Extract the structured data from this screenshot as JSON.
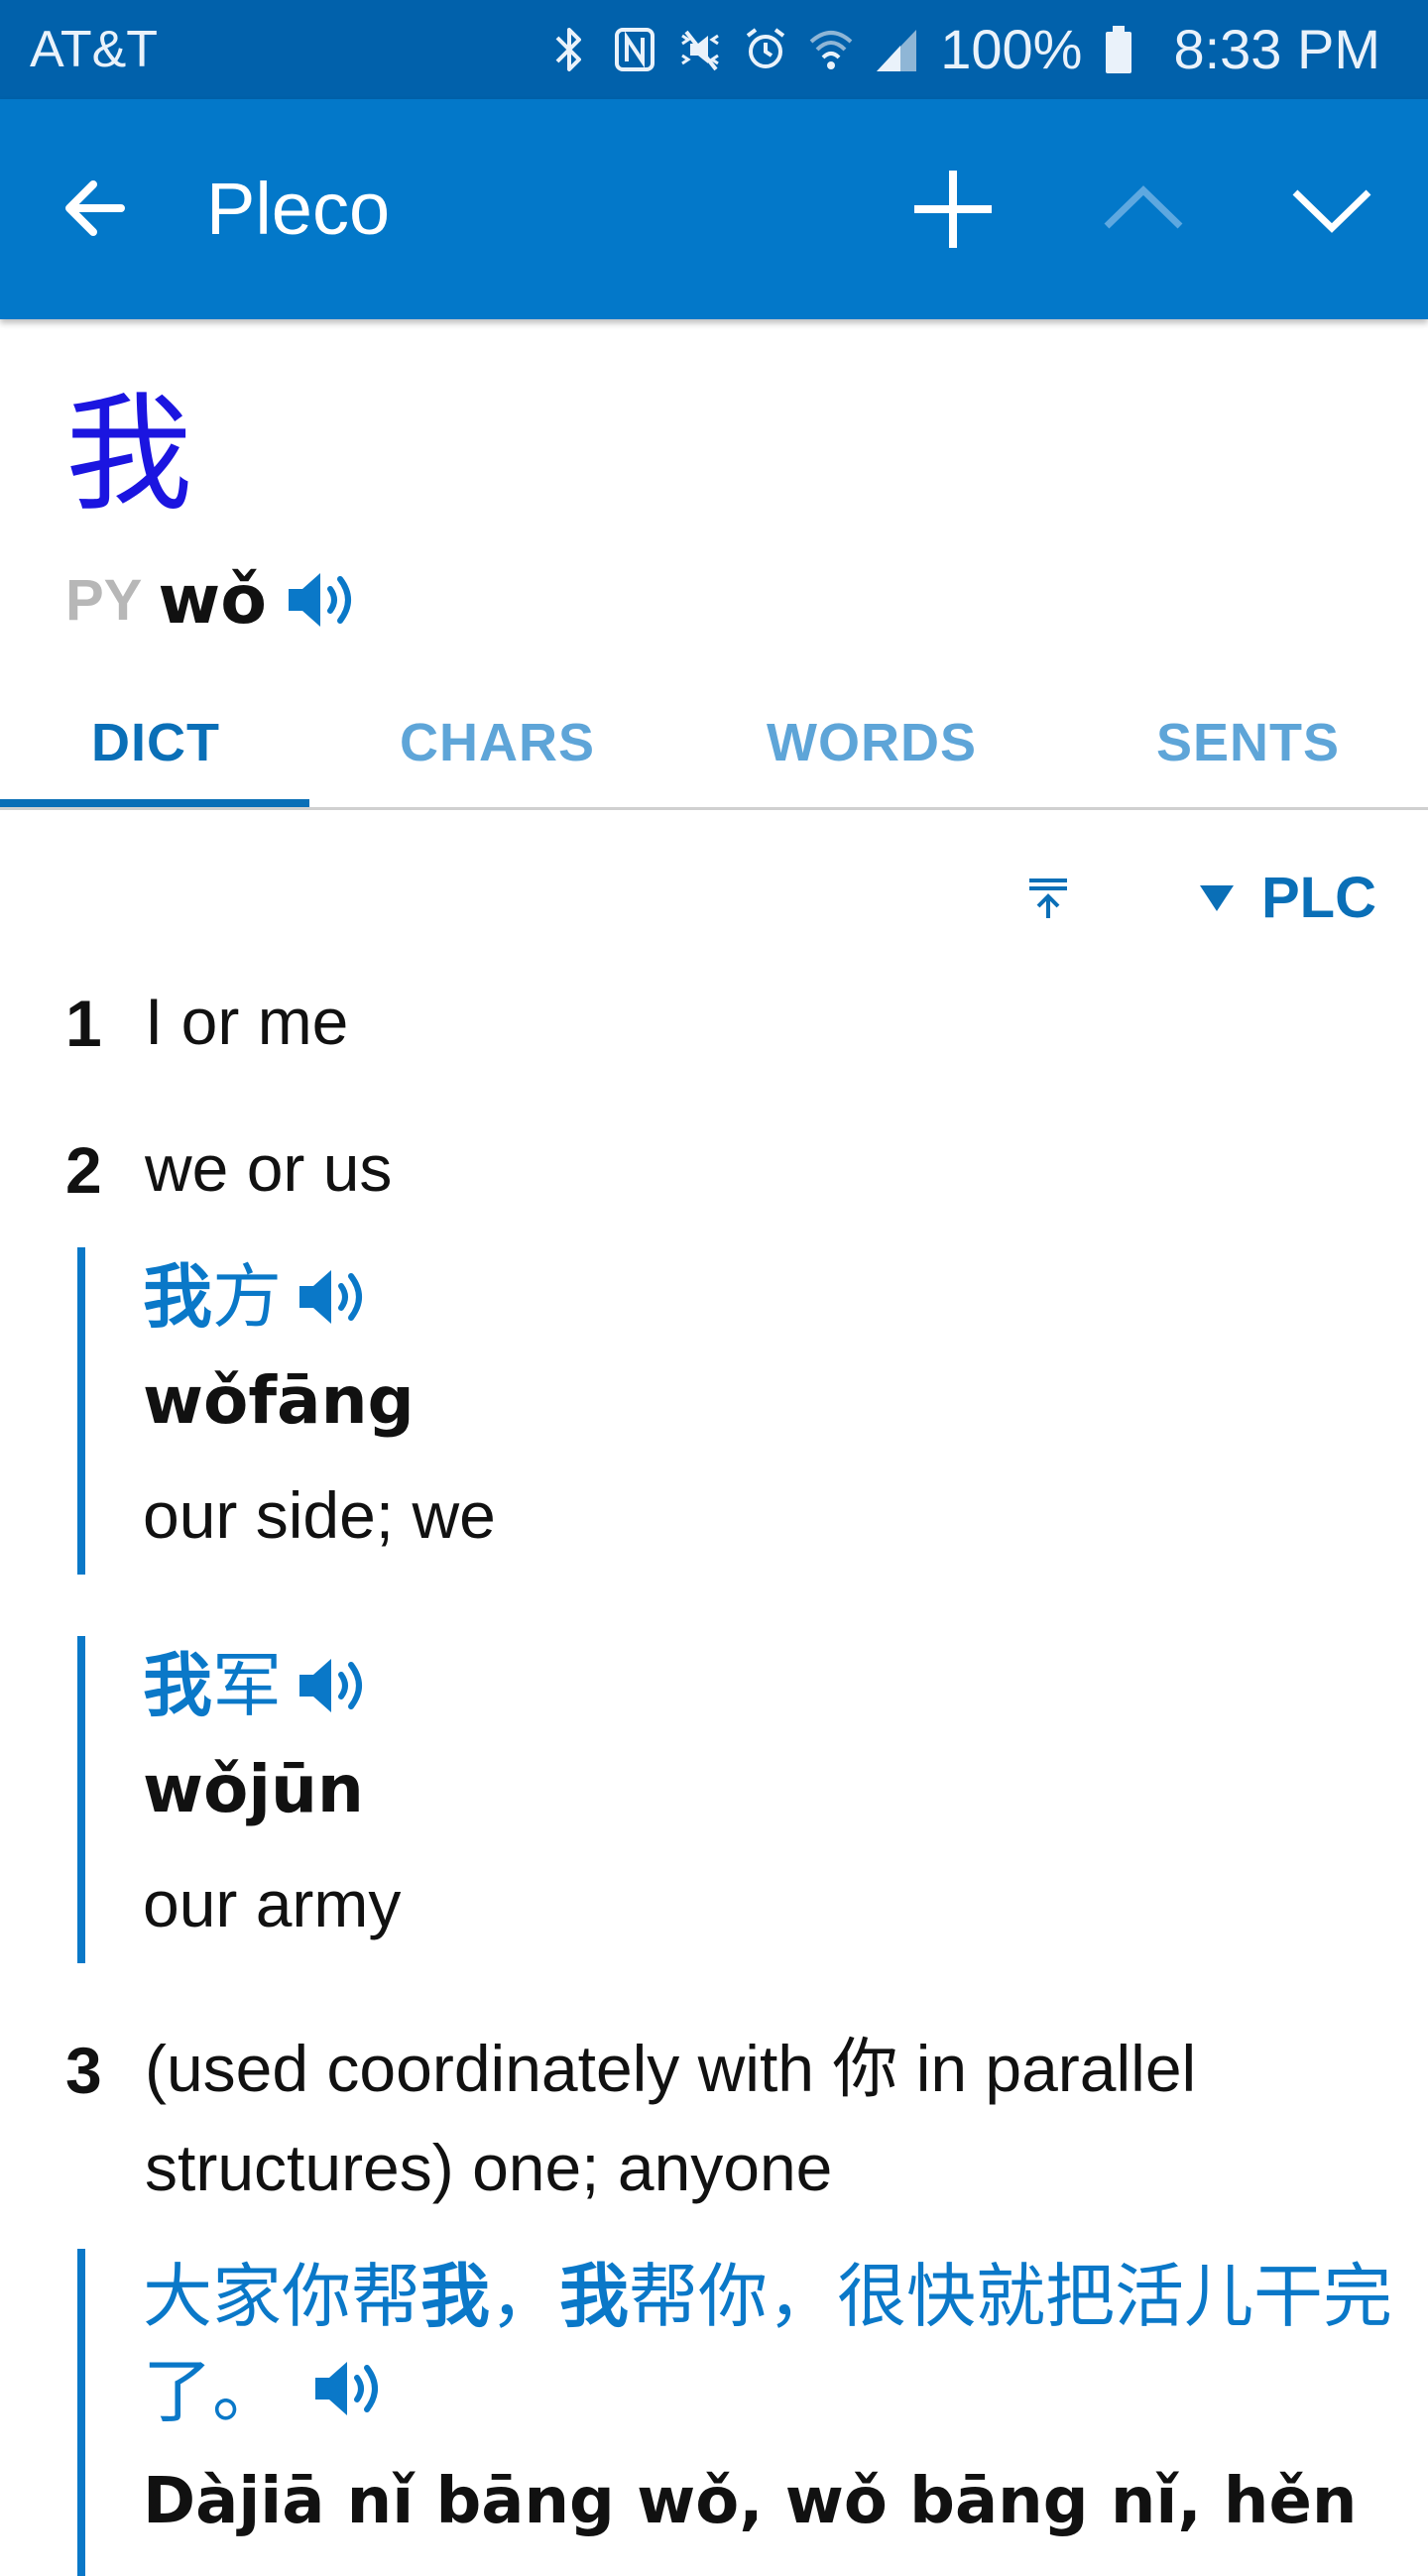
{
  "status_bar": {
    "carrier": "AT&T",
    "battery": "100%",
    "time": "8:33 PM",
    "icons": [
      "bluetooth-icon",
      "nfc-icon",
      "vibrate-icon",
      "alarm-icon",
      "wifi-icon",
      "signal-icon",
      "battery-icon"
    ]
  },
  "app_bar": {
    "title": "Pleco",
    "icons": [
      "back-arrow-icon",
      "add-icon",
      "chevron-up-icon",
      "chevron-down-icon"
    ]
  },
  "entry": {
    "headword": "我",
    "pinyin_tag": "PY",
    "pinyin": "wǒ"
  },
  "tabs": [
    {
      "label": "DICT",
      "active": true
    },
    {
      "label": "CHARS",
      "active": false
    },
    {
      "label": "WORDS",
      "active": false
    },
    {
      "label": "SENTS",
      "active": false
    }
  ],
  "dict_tools": {
    "jump_icon": "jump-to-top-icon",
    "dictionary": "PLC"
  },
  "definitions": [
    {
      "num": "1",
      "text": "I or me"
    },
    {
      "num": "2",
      "text": "we or us",
      "examples": [
        {
          "hanzi_bold": "我",
          "hanzi_rest": "方",
          "pinyin": "wǒfāng",
          "english": "our side; we"
        },
        {
          "hanzi_bold": "我",
          "hanzi_rest": "军",
          "pinyin": "wǒjūn",
          "english": "our army"
        }
      ]
    },
    {
      "num": "3",
      "text": "(used coordinately with 你 in parallel structures) one; anyone",
      "example": {
        "hanzi_parts": [
          "大家你帮",
          "我",
          "，",
          "我",
          "帮你，很快就把活儿干完了。"
        ],
        "pinyin_parts": [
          "Dàjiā nǐ bāng ",
          "wǒ",
          ", ",
          "wǒ",
          " bāng nǐ, hěn"
        ]
      }
    }
  ],
  "colors": {
    "status_bar": "#0161ab",
    "app_bar": "#0378c9",
    "headword": "#1b15e0",
    "accent": "#0a6fb7",
    "tab_inactive": "#5ea5d8"
  }
}
